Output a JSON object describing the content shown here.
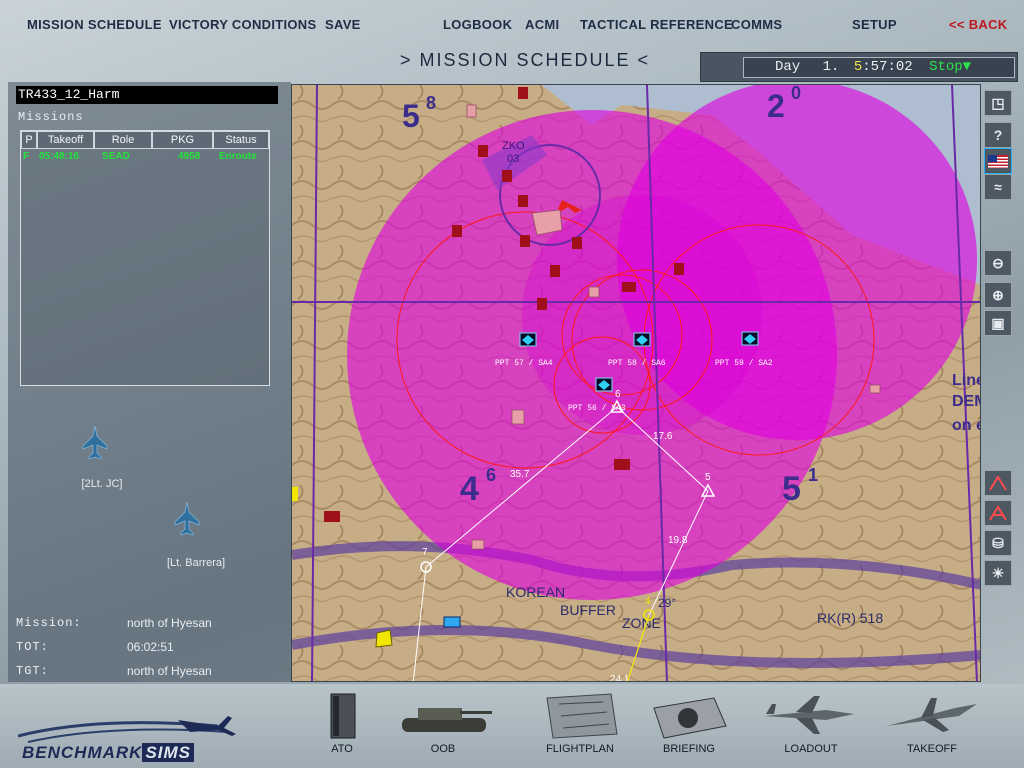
{
  "top_menu": {
    "mission_schedule": "MISSION SCHEDULE",
    "victory_conditions": "VICTORY CONDITIONS",
    "save": "SAVE",
    "logbook": "LOGBOOK",
    "acmi": "ACMI",
    "tactical_reference": "TACTICAL REFERENCE",
    "comms": "COMMS",
    "setup": "SETUP",
    "back": "<< BACK"
  },
  "page_title": ">  MISSION SCHEDULE  <",
  "clock": {
    "day_label": "Day",
    "day": "1.",
    "hour": "5",
    "time_rest": ":57:02",
    "stop_label": "Stop▼"
  },
  "flight": {
    "name": "TR433_12_Harm",
    "missions_title": "Missions",
    "columns": [
      "P",
      "Takeoff",
      "Role",
      "PKG",
      "Status"
    ],
    "rows": [
      {
        "p": "F",
        "takeoff": "05:48:16",
        "role": "SEAD",
        "pkg": "4958",
        "status": "Enroute"
      }
    ],
    "pilots": [
      "[2Lt. JC]",
      "[Lt. Barrera]"
    ]
  },
  "mission_info": {
    "mission_label": "Mission:",
    "mission_value": "north of Hyesan",
    "tot_label": "TOT:",
    "tot_value": "06:02:51",
    "tgt_label": "TGT:",
    "tgt_value": "north of Hyesan"
  },
  "map": {
    "grid_labels": [
      {
        "big": "5",
        "small": "8"
      },
      {
        "big": "2",
        "small": "0"
      },
      {
        "big": "4",
        "small": "6"
      },
      {
        "big": "5",
        "small": "1"
      }
    ],
    "region_text": [
      "KOREAN",
      "BUFFER",
      "ZONE"
    ],
    "road_label": "RK(R) 518",
    "side_text": [
      "Line",
      "DEM",
      "on e"
    ],
    "grid_ref": "29°",
    "airfield_label": [
      "ZKO",
      "03"
    ],
    "steerpoints": [
      "4",
      "5",
      "6",
      "7"
    ],
    "leg_distances": [
      "35.7",
      "17.6",
      "19.8",
      "24.1"
    ],
    "threats": [
      "PPT 57 / SA4",
      "PPT 58 / SA6",
      "PPT 59 / SA2",
      "PPT 56 / SA3"
    ],
    "colors": {
      "threat_ring": "#e000e0",
      "ring_line": "#ff1a1a",
      "route": "#ffffff",
      "route_next": "#f2e600"
    }
  },
  "right_tools": [
    "zoom-fit-icon",
    "help-icon",
    "flag-icon",
    "route-toggle-icon",
    "zoom-out-icon",
    "zoom-in-icon",
    "zoom-reset-icon",
    "altitude-profile-icon",
    "altitude-profile-2-icon",
    "database-icon",
    "weather-icon"
  ],
  "bottom_buttons": {
    "ato": "ATO",
    "oob": "OOB",
    "flightplan": "FLIGHTPLAN",
    "briefing": "BRIEFING",
    "loadout": "LOADOUT",
    "takeoff": "TAKEOFF"
  },
  "logo": {
    "text": "BENCHMARK",
    "sims": "SIMS"
  }
}
